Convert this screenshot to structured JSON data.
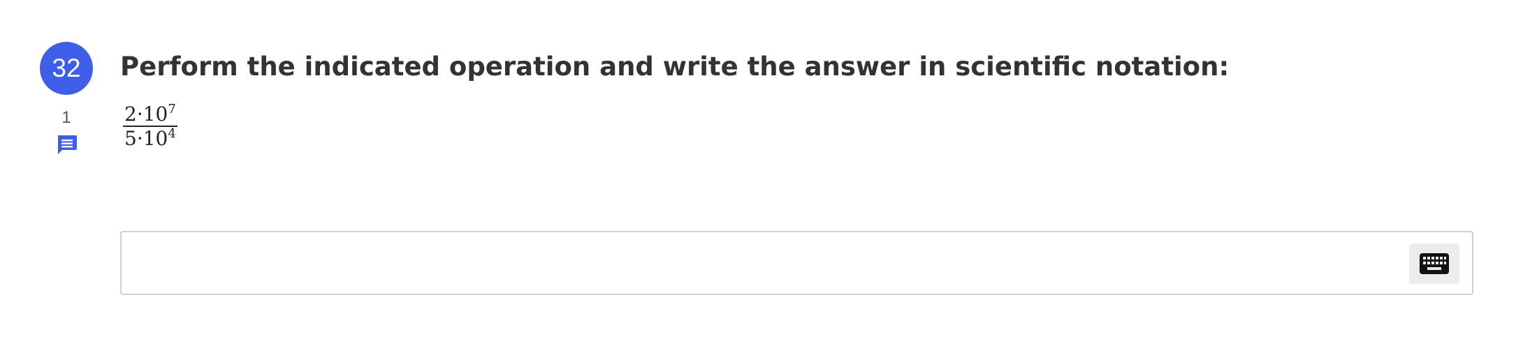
{
  "question": {
    "number": "32",
    "points": "1",
    "prompt": "Perform the indicated operation and write the answer in scientific notation:",
    "expression": {
      "numerator": {
        "coefficient": "2",
        "operator": "·",
        "base": "10",
        "exponent": "7"
      },
      "denominator": {
        "coefficient": "5",
        "operator": "·",
        "base": "10",
        "exponent": "4"
      }
    }
  },
  "answer": {
    "value": "",
    "placeholder": ""
  },
  "icons": {
    "comment": "comment-icon",
    "keyboard": "keyboard-icon"
  },
  "colors": {
    "badge": "#3f5ee8",
    "comment_icon": "#3f5ee8",
    "text": "#333333",
    "input_border": "#cfcfcf",
    "keyboard_button_bg": "#ececec"
  }
}
